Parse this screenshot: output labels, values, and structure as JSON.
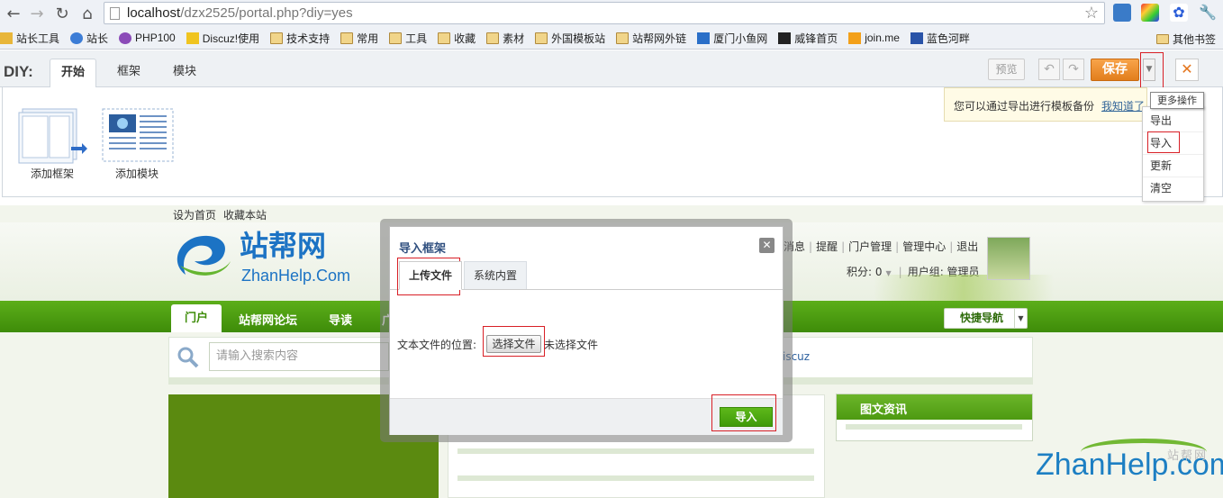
{
  "browser": {
    "url_host": "localhost",
    "url_path": "/dzx2525/portal.php?diy=yes",
    "bookmarks": [
      "站长工具",
      "站长",
      "PHP100",
      "Discuz!使用",
      "技术支持",
      "常用",
      "工具",
      "收藏",
      "素材",
      "外国模板站",
      "站帮网外链",
      "厦门小鱼网",
      "威锋首页",
      "join.me",
      "蓝色河畔"
    ],
    "other_bookmarks": "其他书签"
  },
  "diy": {
    "label": "DIY:",
    "tabs": [
      "开始",
      "框架",
      "模块"
    ],
    "preview": "预览",
    "save": "保存",
    "tools": [
      "添加框架",
      "添加模块"
    ],
    "tip_text": "您可以通过导出进行模板备份",
    "tip_link": "我知道了",
    "tooltip": "更多操作",
    "menu": [
      "导出",
      "导入",
      "更新",
      "清空"
    ]
  },
  "site": {
    "top_links": [
      "设为首页",
      "收藏本站"
    ],
    "logo_text": "ZhanHelp.Com",
    "user_links": [
      "消息",
      "|",
      "提醒",
      "|",
      "门户管理",
      "|",
      "管理中心",
      "|",
      "退出"
    ],
    "points_label": "积分: 0",
    "user_group": "用户组: 管理员",
    "nav": [
      "门户",
      "站帮网论坛",
      "导读",
      "广"
    ],
    "quick_nav": "快捷导航",
    "search_placeholder": "请输入搜索内容",
    "search_extra": "iscuz",
    "side_box_title": "图文资讯"
  },
  "modal": {
    "title": "导入框架",
    "tabs": [
      "上传文件",
      "系统内置"
    ],
    "file_label": "文本文件的位置:",
    "file_button": "选择文件",
    "file_none": "未选择文件",
    "submit": "导入"
  },
  "watermark": {
    "text": "ZhanHelp.com",
    "cn": "站帮网"
  },
  "colors": {
    "accent_green": "#4d9a11",
    "save_orange": "#e27e1c",
    "highlight_red": "#d81f26"
  }
}
